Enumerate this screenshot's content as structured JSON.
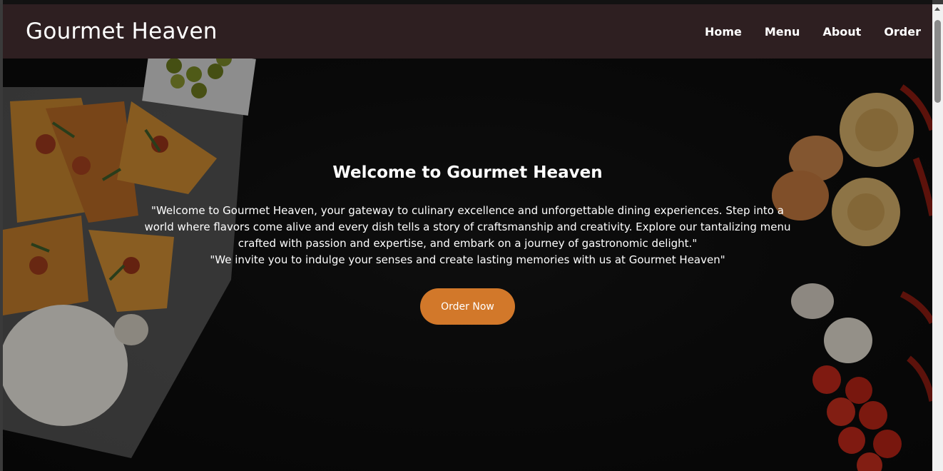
{
  "brand": {
    "name": "Gourmet Heaven"
  },
  "nav": {
    "items": [
      {
        "label": "Home"
      },
      {
        "label": "Menu"
      },
      {
        "label": "About"
      },
      {
        "label": "Order"
      }
    ]
  },
  "hero": {
    "title": "Welcome to Gourmet Heaven",
    "paragraph1": "\"Welcome to Gourmet Heaven, your gateway to culinary excellence and unforgettable dining experiences. Step into a world where flavors come alive and every dish tells a story of craftsmanship and creativity. Explore our tantalizing menu crafted with passion and expertise, and embark on a journey of gastronomic delight.\"",
    "paragraph2": "\"We invite you to indulge your senses and create lasting memories with us at Gourmet Heaven\"",
    "cta_label": "Order Now"
  },
  "colors": {
    "navbar_bg": "#2e1f21",
    "cta_bg": "#d2782a",
    "hero_bg": "#121212",
    "text": "#ffffff"
  }
}
